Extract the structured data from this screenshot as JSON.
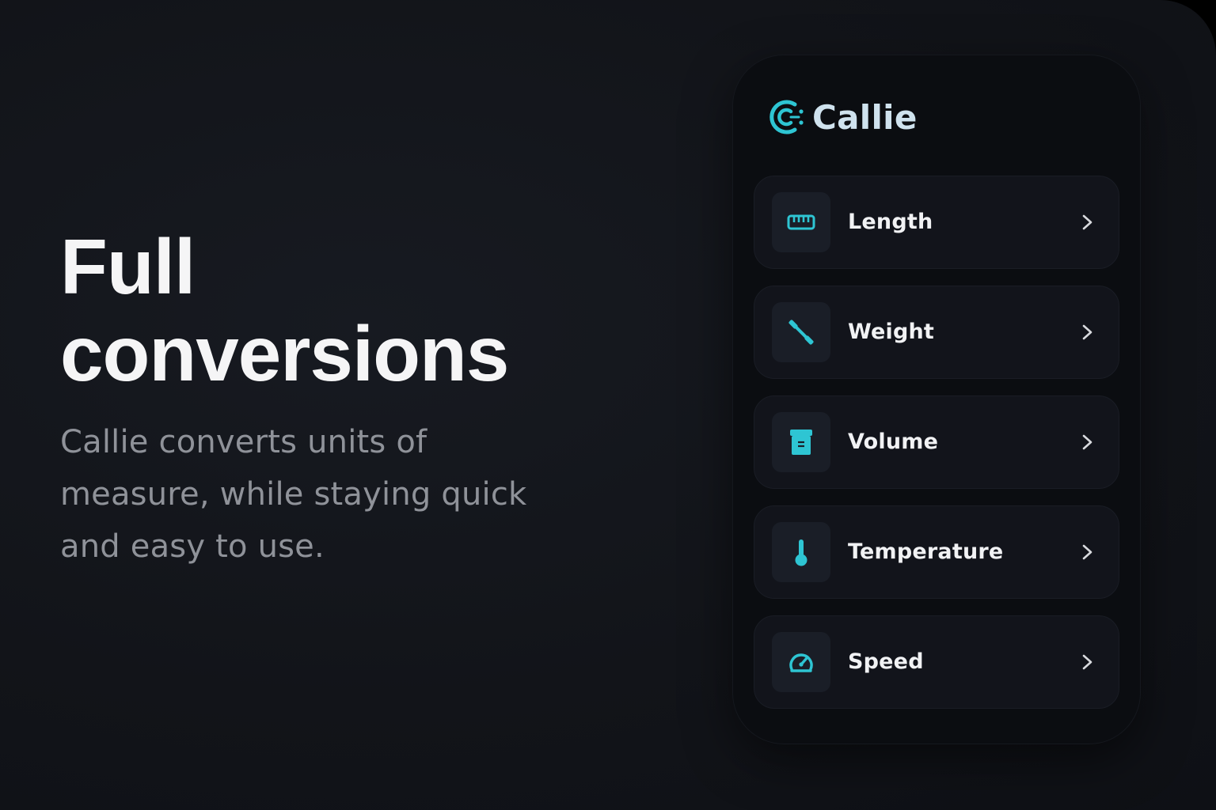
{
  "hero": {
    "headline_line1": "Full",
    "headline_line2": "conversions",
    "subcopy_line1": "Callie converts units of",
    "subcopy_line2": "measure, while staying quick",
    "subcopy_line3": "and easy to use."
  },
  "app": {
    "name": "Callie",
    "logo_icon": "callie-logo-icon",
    "accent_color": "#2ec5d3"
  },
  "categories": [
    {
      "label": "Length",
      "icon": "ruler-icon"
    },
    {
      "label": "Weight",
      "icon": "dumbbell-icon"
    },
    {
      "label": "Volume",
      "icon": "container-icon"
    },
    {
      "label": "Temperature",
      "icon": "thermometer-icon"
    },
    {
      "label": "Speed",
      "icon": "speedometer-icon"
    }
  ]
}
